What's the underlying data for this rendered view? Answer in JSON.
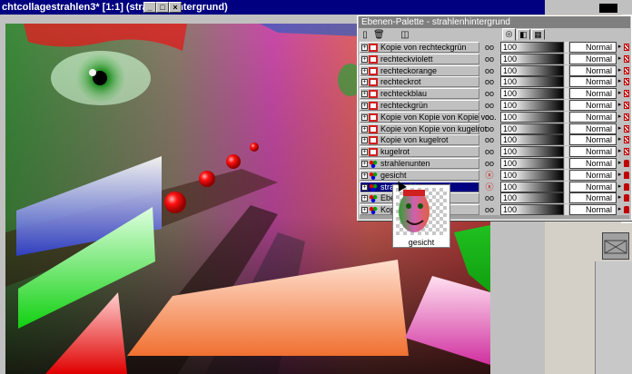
{
  "document": {
    "title": "chtcollagestrahlen3* [1:1] (strahlenhintergrund)",
    "minimize_glyph": "_",
    "maximize_glyph": "□",
    "close_glyph": "×"
  },
  "palette": {
    "title": "Ebenen-Palette - strahlenhintergrund",
    "layers": [
      {
        "name": "Kopie von rechteckgrün",
        "icon": "rect",
        "opacity": "100",
        "blend": "Normal",
        "visible": true,
        "lock": "x"
      },
      {
        "name": "rechteckviolett",
        "icon": "rect",
        "opacity": "100",
        "blend": "Normal",
        "visible": true,
        "lock": "x"
      },
      {
        "name": "rechteckorange",
        "icon": "rect",
        "opacity": "100",
        "blend": "Normal",
        "visible": true,
        "lock": "x"
      },
      {
        "name": "rechteckrot",
        "icon": "rect",
        "opacity": "100",
        "blend": "Normal",
        "visible": true,
        "lock": "x"
      },
      {
        "name": "rechteckblau",
        "icon": "rect",
        "opacity": "100",
        "blend": "Normal",
        "visible": true,
        "lock": "x"
      },
      {
        "name": "rechteckgrün",
        "icon": "rect",
        "opacity": "100",
        "blend": "Normal",
        "visible": true,
        "lock": "x"
      },
      {
        "name": "Kopie von Kopie von Kopie vo...",
        "icon": "rect",
        "opacity": "100",
        "blend": "Normal",
        "visible": true,
        "lock": "x"
      },
      {
        "name": "Kopie von Kopie von kugelrot",
        "icon": "rect",
        "opacity": "100",
        "blend": "Normal",
        "visible": true,
        "lock": "x"
      },
      {
        "name": "Kopie von kugelrot",
        "icon": "rect",
        "opacity": "100",
        "blend": "Normal",
        "visible": true,
        "lock": "x"
      },
      {
        "name": "kugelrot",
        "icon": "rect",
        "opacity": "100",
        "blend": "Normal",
        "visible": true,
        "lock": "x"
      },
      {
        "name": "strahlenunten",
        "icon": "dots",
        "opacity": "100",
        "blend": "Normal",
        "visible": true,
        "lock": "lk"
      },
      {
        "name": "gesicht",
        "icon": "dots",
        "opacity": "100",
        "blend": "Normal",
        "visible": false,
        "lock": "lk"
      },
      {
        "name": "strahlenhintergrund",
        "icon": "dots",
        "opacity": "100",
        "blend": "Normal",
        "visible": false,
        "lock": "lk",
        "selected": true
      },
      {
        "name": "Ebene",
        "icon": "dots",
        "opacity": "100",
        "blend": "Normal",
        "visible": true,
        "lock": "lk"
      },
      {
        "name": "Kopie",
        "icon": "dots",
        "opacity": "100",
        "blend": "Normal",
        "visible": true,
        "lock": "lk"
      }
    ]
  },
  "drag_preview": {
    "label": "gesicht"
  },
  "icons": {
    "visible": "oo",
    "hidden": "ⓧ",
    "expand": "+",
    "spin": "⇕",
    "arrow": "▸"
  },
  "colors": {
    "titlebar_active": "#000080",
    "titlebar_inactive": "#7f7f7f",
    "selection": "#000080"
  }
}
